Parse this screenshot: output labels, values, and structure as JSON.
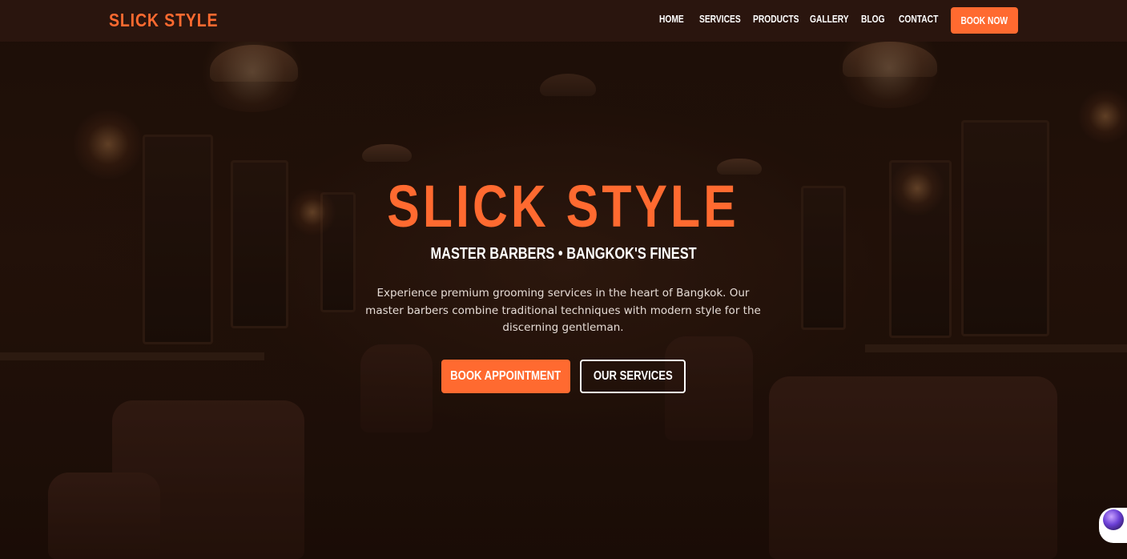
{
  "header": {
    "logo": "SLICK STYLE",
    "nav": [
      "HOME",
      "SERVICES",
      "PRODUCTS",
      "GALLERY",
      "BLOG",
      "CONTACT"
    ],
    "book_now": "BOOK NOW"
  },
  "hero": {
    "title": "SLICK STYLE",
    "subtitle": "MASTER BARBERS • BANGKOK'S FINEST",
    "description": "Experience premium grooming services in the heart of Bangkok. Our master barbers combine traditional techniques with modern style for the discerning gentleman.",
    "primary_button": "BOOK APPOINTMENT",
    "secondary_button": "OUR SERVICES"
  },
  "colors": {
    "accent": "#ff6a30",
    "header_bg": "#2a150e",
    "page_bg": "#1c0f0a",
    "text": "#ffffff"
  },
  "icons": {
    "chat_widget": "chat-assistant-icon"
  }
}
